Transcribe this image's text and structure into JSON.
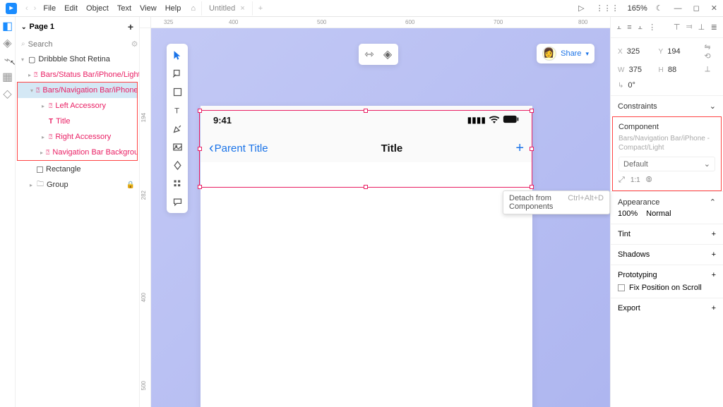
{
  "menu": [
    "File",
    "Edit",
    "Object",
    "Text",
    "View",
    "Help"
  ],
  "doc_tab": "Untitled",
  "zoom": "165%",
  "pages_header": "Page 1",
  "search_placeholder": "Search",
  "layers": {
    "root": "Dribbble Shot Retina",
    "status_bar": "Bars/Status Bar/iPhone/Light",
    "nav_bar": "Bars/Navigation Bar/iPhone - ...",
    "left_acc": "Left Accessory",
    "title": "Title",
    "right_acc": "Right Accessory",
    "nav_bg": "Navigation Bar Background",
    "rectangle": "Rectangle",
    "group": "Group"
  },
  "ruler_h": [
    "325",
    "400",
    "500",
    "600",
    "700",
    "800"
  ],
  "ruler_v": [
    "194",
    "282",
    "400",
    "500"
  ],
  "share": "Share",
  "artboard": {
    "time": "9:41",
    "parent_title": "Parent Title",
    "title": "Title"
  },
  "tooltip": {
    "text": "Detach from Components",
    "kbd": "Ctrl+Alt+D"
  },
  "inspector": {
    "x_label": "X",
    "x": "325",
    "y_label": "Y",
    "y": "194",
    "w_label": "W",
    "w": "375",
    "h_label": "H",
    "h": "88",
    "rot_label": "↳",
    "rot": "0°",
    "constraints": "Constraints",
    "component": "Component",
    "comp_path": "Bars/Navigation Bar/iPhone - Compact/Light",
    "variant": "Default",
    "ratio": "1:1",
    "appearance": "Appearance",
    "opacity": "100%",
    "blend": "Normal",
    "tint": "Tint",
    "shadows": "Shadows",
    "prototyping": "Prototyping",
    "fix_scroll": "Fix Position on Scroll",
    "export": "Export"
  }
}
